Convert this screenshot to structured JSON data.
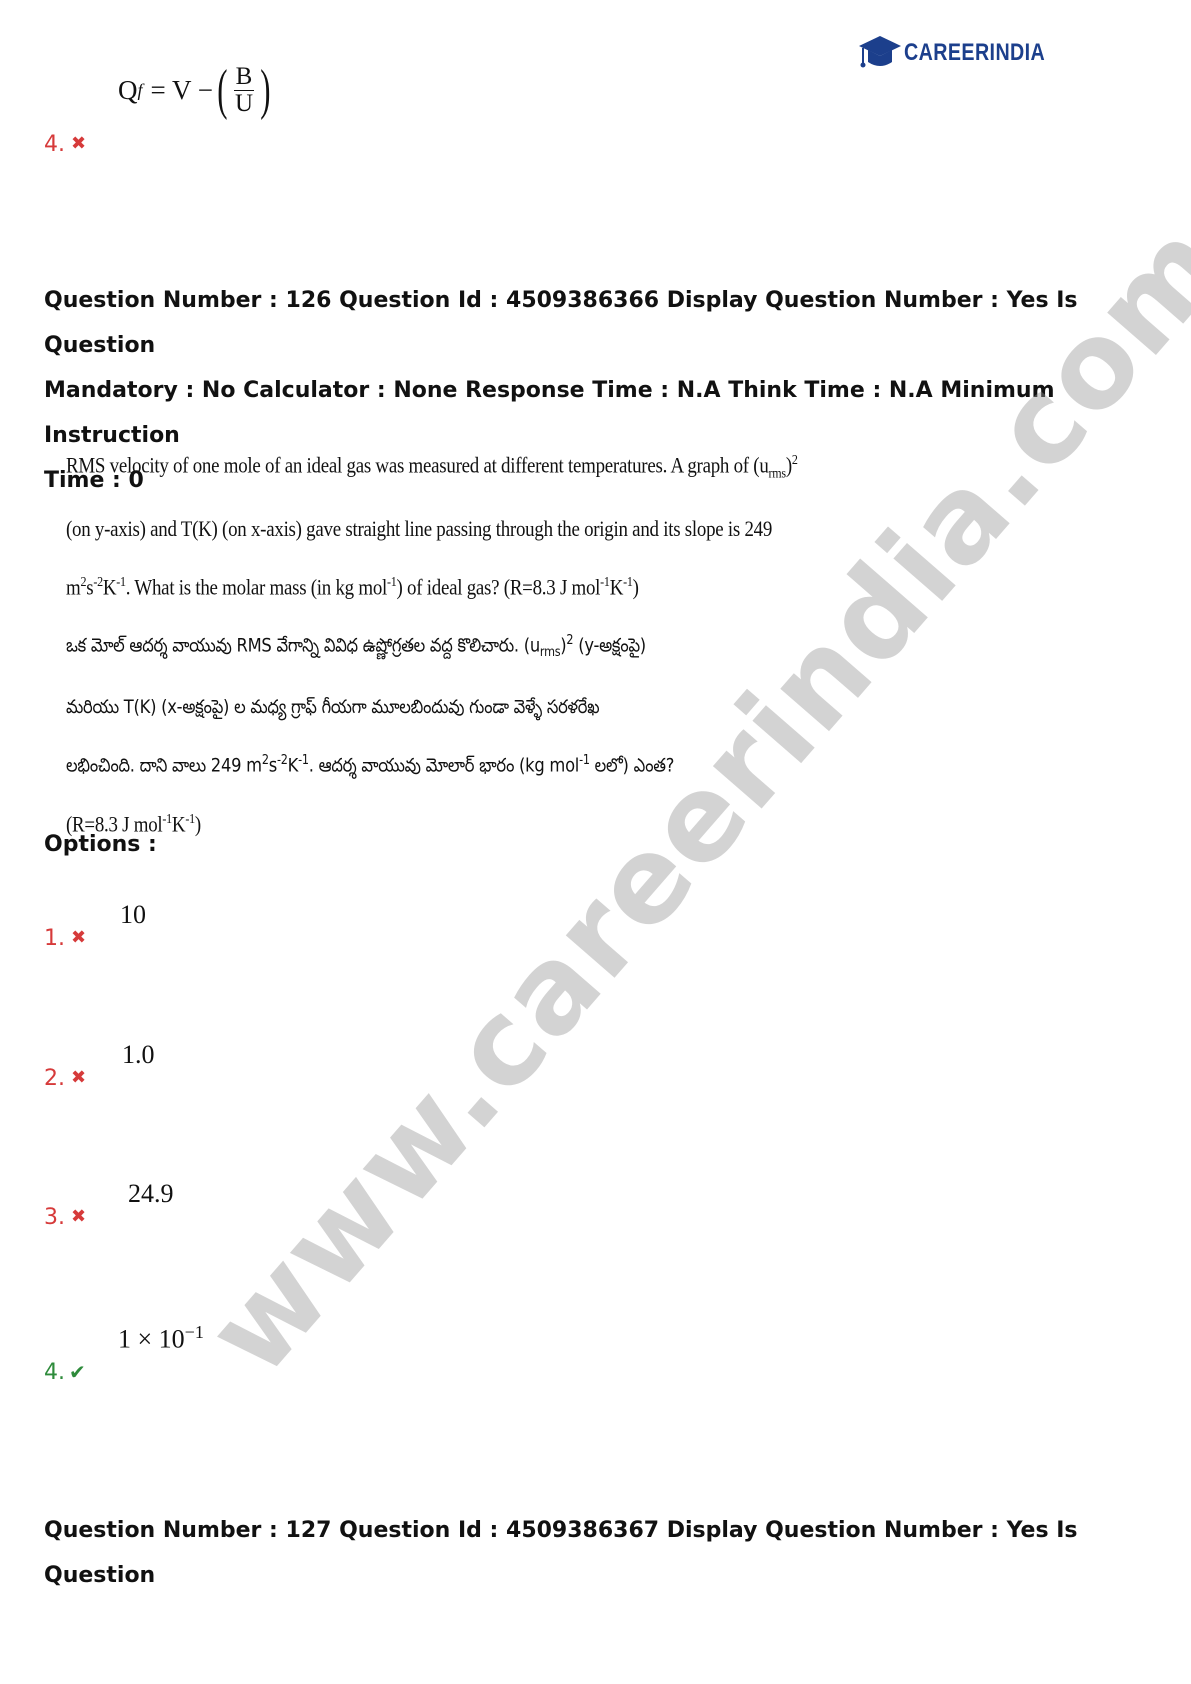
{
  "header": {
    "logo_text": "CAREERINDIA",
    "logo_icon": "graduation-cap-icon",
    "brand_color": "#1c3f8c"
  },
  "prev_question": {
    "formula": {
      "lhs": "Q",
      "lhs_sub": "f",
      "rhs": "= V −",
      "numerator": "B",
      "denominator": "U"
    },
    "option_number": "4."
  },
  "question": {
    "meta_line1": "Question Number : 126 Question Id : 4509386366 Display Question Number : Yes Is Question",
    "meta_line2": "Mandatory : No Calculator : None Response Time : N.A Think Time : N.A Minimum Instruction",
    "meta_line3": "Time : 0",
    "en": {
      "p1": "RMS velocity of one mole of an ideal gas was measured at different temperatures. A graph of (u",
      "p1_sub": "rms",
      "p1_end": ")",
      "p1_sup": "2",
      "p2": "(on y-axis) and T(K) (on x-axis) gave straight line passing through the origin and its slope is 249",
      "p3_a": "m",
      "p3_sup1": "2",
      "p3_b": "s",
      "p3_sup2": "-2",
      "p3_c": "K",
      "p3_sup3": "-1",
      "p3_d": ". What is the molar mass (in kg mol",
      "p3_sup4": "-1",
      "p3_e": ") of ideal gas? (R=8.3 J mol",
      "p3_sup5": "-1",
      "p3_f": "K",
      "p3_sup6": "-1",
      "p3_g": ")"
    },
    "te": {
      "l1_a": "ఒక మోల్ ఆదర్శ వాయువు RMS వేగాన్ని వివిధ ఉష్ణోగ్రతల వద్ద కొలిచారు. (u",
      "l1_sub": "rms",
      "l1_b": ")",
      "l1_sup": "2",
      "l1_c": " (y-అక్షంపై)",
      "l2": "మరియు T(K) (x-అక్షంపై) ల మధ్య గ్రాఫ్ గీయగా మూలబిందువు గుండా వెళ్ళే సరళరేఖ",
      "l3_a": "లభించింది. దాని వాలు 249 m",
      "l3_sup1": "2",
      "l3_b": "s",
      "l3_sup2": "-2",
      "l3_c": "K",
      "l3_sup3": "-1",
      "l3_d": ". ఆదర్శ వాయువు మోలార్ భారం (kg mol",
      "l3_sup4": "-1",
      "l3_e": " లలో) ఎంత?",
      "l4_a": "(R=8.3 J mol",
      "l4_sup1": "-1",
      "l4_b": "K",
      "l4_sup2": "-1",
      "l4_c": ")"
    }
  },
  "options_label": "Options :",
  "options": [
    {
      "number": "1.",
      "value": "10",
      "status": "wrong"
    },
    {
      "number": "2.",
      "value": "1.0",
      "status": "wrong"
    },
    {
      "number": "3.",
      "value": "24.9",
      "status": "wrong"
    },
    {
      "number": "4.",
      "value_base": "1 × 10",
      "value_exp": "−1",
      "status": "correct"
    }
  ],
  "next_question": {
    "meta_line1": "Question Number : 127 Question Id : 4509386367 Display Question Number : Yes Is Question"
  },
  "watermark": "www.careerindia.com",
  "colors": {
    "wrong": "#d63a3a",
    "correct": "#2e8b3b"
  }
}
